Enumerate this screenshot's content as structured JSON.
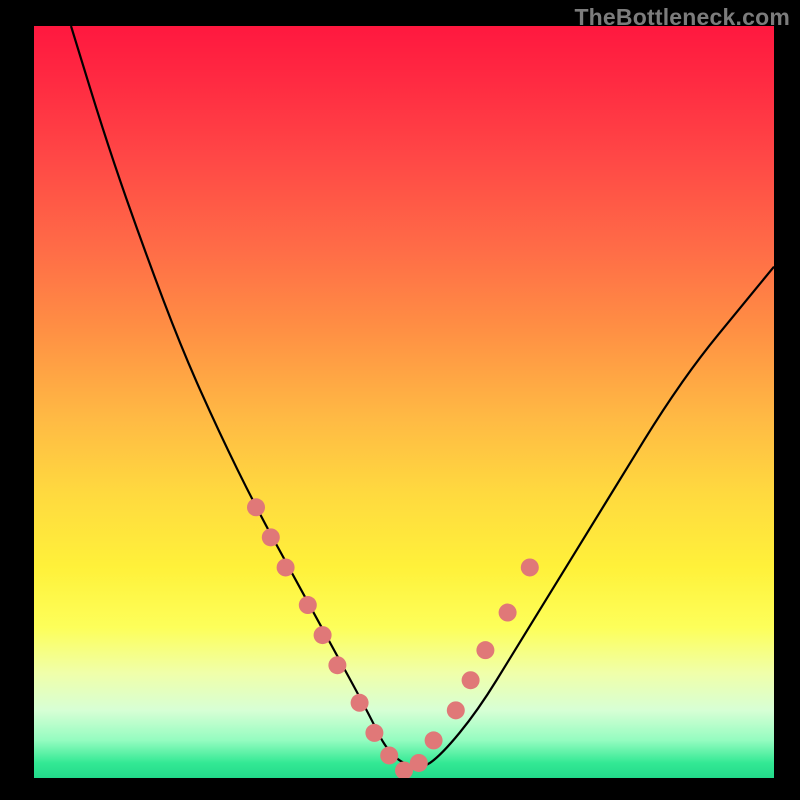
{
  "watermark": "TheBottleneck.com",
  "chart_data": {
    "type": "line",
    "title": "",
    "xlabel": "",
    "ylabel": "",
    "xlim": [
      0,
      100
    ],
    "ylim": [
      0,
      100
    ],
    "series": [
      {
        "name": "bottleneck-curve",
        "x": [
          5,
          10,
          15,
          20,
          25,
          30,
          35,
          40,
          45,
          48,
          52,
          55,
          60,
          65,
          70,
          75,
          80,
          85,
          90,
          95,
          100
        ],
        "values": [
          100,
          84,
          70,
          57,
          46,
          36,
          27,
          18,
          9,
          3,
          1,
          3,
          9,
          17,
          25,
          33,
          41,
          49,
          56,
          62,
          68
        ]
      }
    ],
    "markers": {
      "name": "sample-points",
      "color": "#e07878",
      "x": [
        30,
        32,
        34,
        37,
        39,
        41,
        44,
        46,
        48,
        50,
        52,
        54,
        57,
        59,
        61,
        64,
        67
      ],
      "values": [
        36,
        32,
        28,
        23,
        19,
        15,
        10,
        6,
        3,
        1,
        2,
        5,
        9,
        13,
        17,
        22,
        28
      ]
    },
    "gradient_stops": [
      {
        "pos": 0,
        "color": "#ff183f"
      },
      {
        "pos": 30,
        "color": "#ff6d47"
      },
      {
        "pos": 62,
        "color": "#ffd93f"
      },
      {
        "pos": 86,
        "color": "#f0ffa9"
      },
      {
        "pos": 100,
        "color": "#22d98a"
      }
    ]
  }
}
